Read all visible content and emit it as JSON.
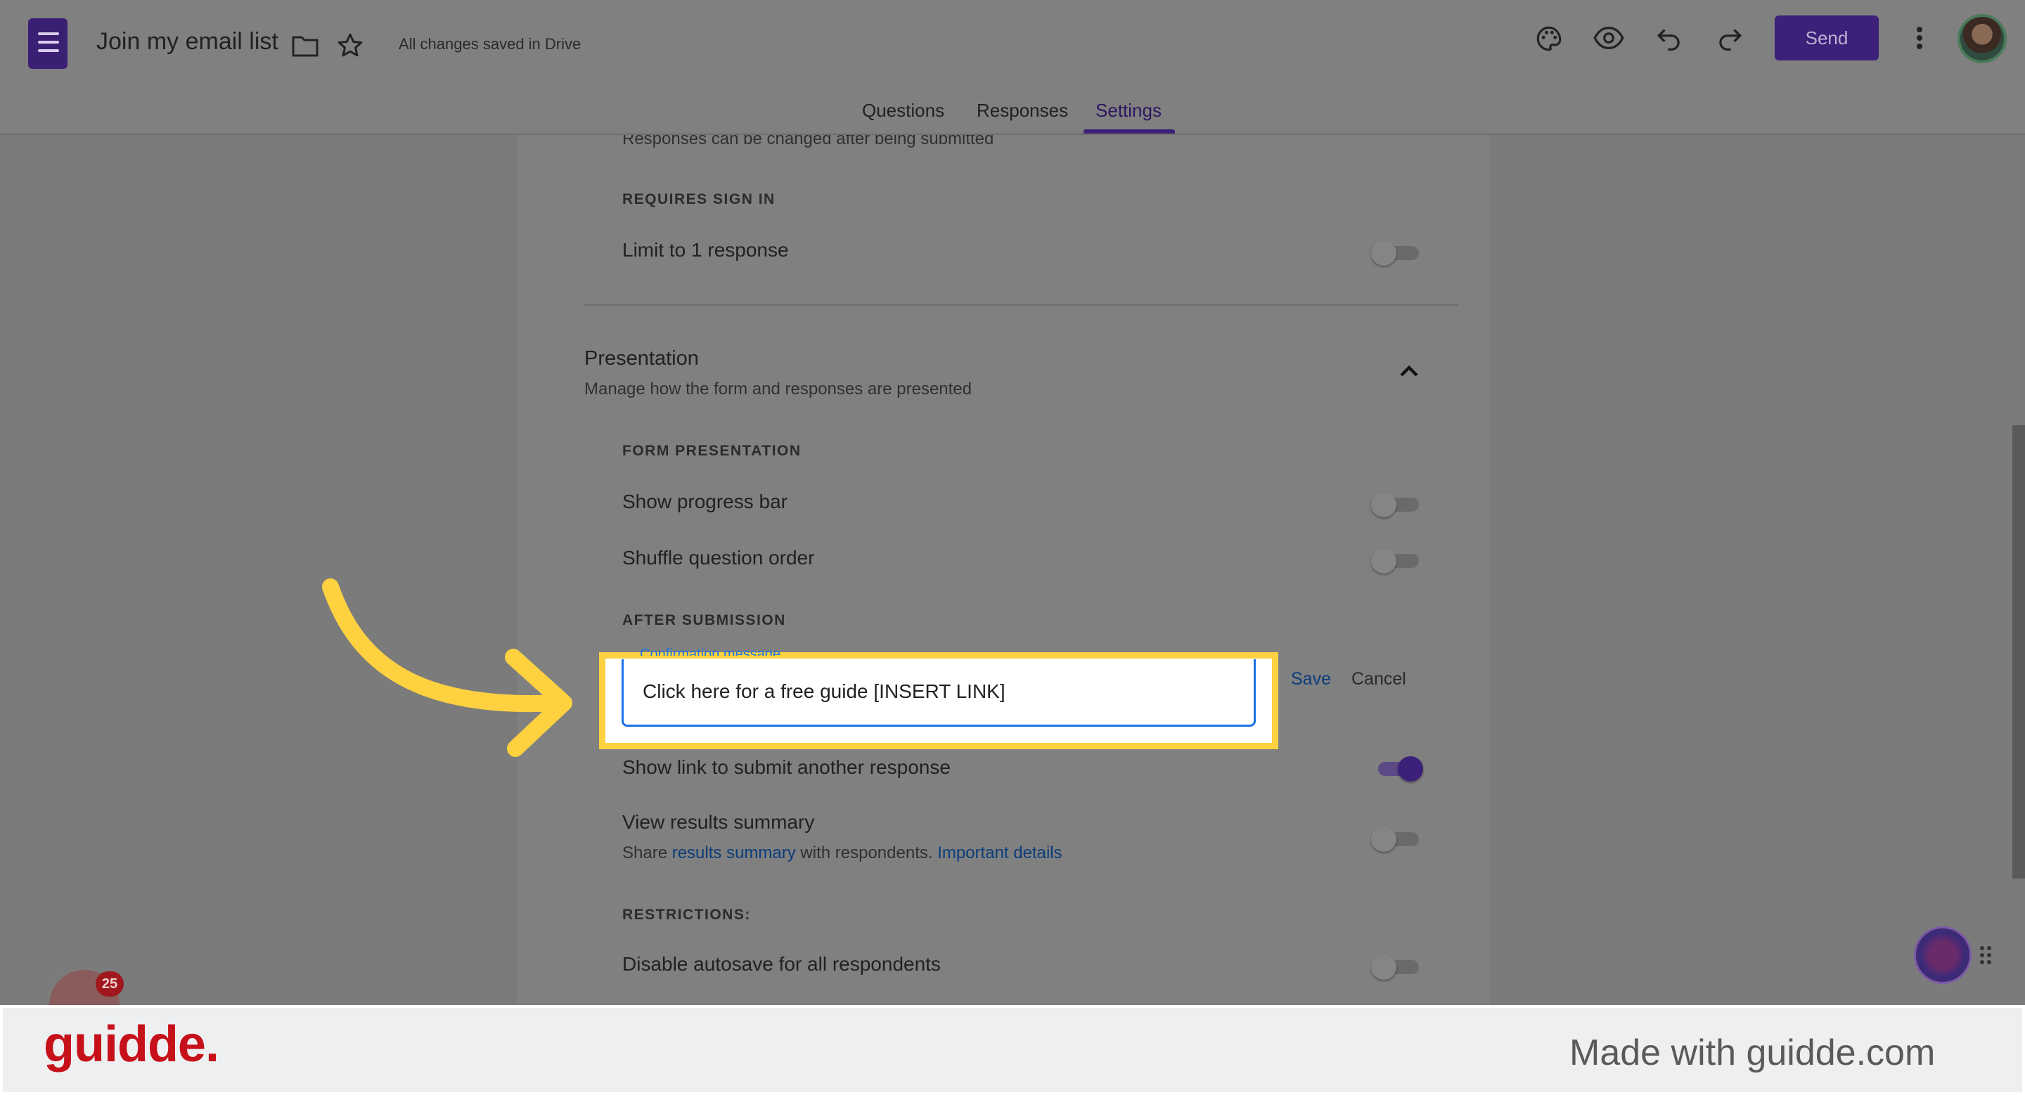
{
  "header": {
    "doc_title": "Join my email list",
    "save_status": "All changes saved in Drive",
    "send_label": "Send",
    "icons": [
      "forms-icon",
      "folder-icon",
      "star-icon",
      "palette-icon",
      "preview-icon",
      "undo-icon",
      "redo-icon",
      "more-vert-icon",
      "avatar"
    ]
  },
  "tabs": [
    {
      "label": "Questions",
      "active": false
    },
    {
      "label": "Responses",
      "active": false
    },
    {
      "label": "Settings",
      "active": true
    }
  ],
  "settings": {
    "partial_top_text": "Responses can be changed after being submitted",
    "requires_sign_in": "REQUIRES SIGN IN",
    "limit_response": "Limit to 1 response",
    "presentation": {
      "title": "Presentation",
      "subtitle": "Manage how the form and responses are presented"
    },
    "form_presentation": "FORM PRESENTATION",
    "show_progress_bar": "Show progress bar",
    "shuffle_question_order": "Shuffle question order",
    "after_submission": "AFTER SUBMISSION",
    "confirmation": {
      "floating_label": "Confirmation message",
      "value": "Click here for a free guide [INSERT LINK]",
      "save": "Save",
      "cancel": "Cancel"
    },
    "show_link_another": "Show link to submit another response",
    "view_results": "View results summary",
    "share_prefix": "Share",
    "results_summary_link": "results summary",
    "share_middle": "with respondents.",
    "important_details_link": "Important details",
    "restrictions": "RESTRICTIONS:",
    "disable_autosave": "Disable autosave for all respondents"
  },
  "toggles": {
    "limit_response": false,
    "show_progress_bar": false,
    "shuffle_question_order": false,
    "show_link_another": true,
    "view_results": false,
    "disable_autosave": false
  },
  "extension_badge_count": "25",
  "footer": {
    "logo": "guidde.",
    "made_with": "Made with guidde.com"
  },
  "colors": {
    "brand_purple": "#3c2079",
    "highlight_yellow": "#fdd13f",
    "link_blue": "#0b3d7a",
    "guidde_red": "#c6111b"
  }
}
